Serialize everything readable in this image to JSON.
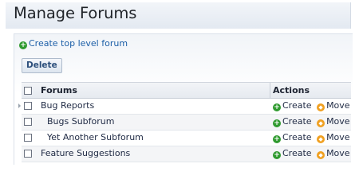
{
  "header": {
    "title": "Manage Forums"
  },
  "toolbar": {
    "create_label": "Create top level forum",
    "delete_label": "Delete"
  },
  "table": {
    "columns": [
      "Forums",
      "Actions"
    ],
    "rows": [
      {
        "name": "Bug Reports",
        "level": 0,
        "expandable": true
      },
      {
        "name": "Bugs Subforum",
        "level": 1,
        "expandable": false
      },
      {
        "name": "Yet Another Subforum",
        "level": 1,
        "expandable": false
      },
      {
        "name": "Feature Suggestions",
        "level": 0,
        "expandable": false
      }
    ],
    "actions": {
      "create_label": "Create",
      "move_label": "Move"
    }
  },
  "icons": {
    "create": "plus-circle-icon",
    "move": "move-circle-icon",
    "expander": "expand-arrow-icon"
  },
  "colors": {
    "link": "#1d5fa8",
    "create_icon": "#2f9a2f",
    "move_icon": "#f0a020",
    "title_bar": "#e8edf3"
  }
}
